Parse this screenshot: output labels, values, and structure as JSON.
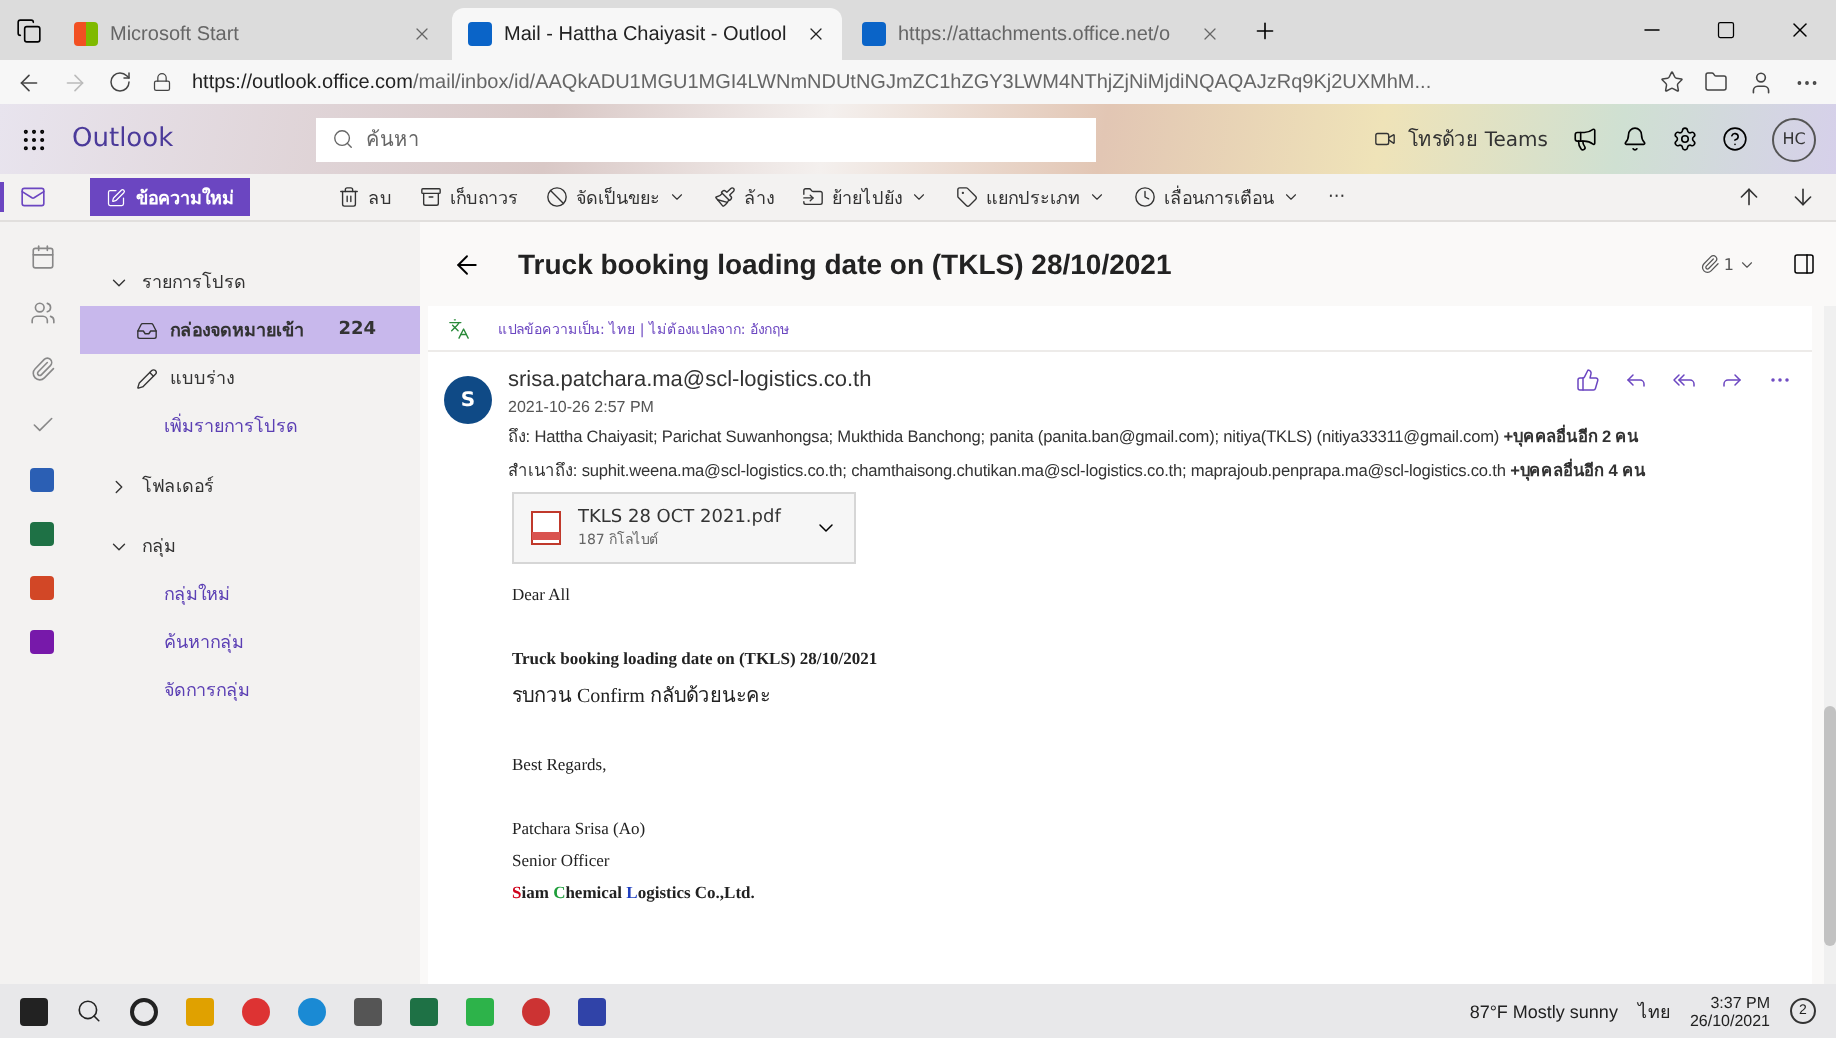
{
  "browser": {
    "tabs": [
      {
        "title": "Microsoft Start",
        "selected": false
      },
      {
        "title": "Mail - Hattha Chaiyasit - Outlool",
        "selected": true
      },
      {
        "title": "https://attachments.office.net/o",
        "selected": false
      }
    ],
    "url_host": "https://outlook.office.com",
    "url_path": "/mail/inbox/id/AAQkADU1MGU1MGI4LWNmNDUtNGJmZC1hZGY3LWM4NThjZjNiMjdiNQAQAJzRq9Kj2UXMhM..."
  },
  "header": {
    "app_name": "Outlook",
    "search_placeholder": "ค้นหา",
    "teams_label": "โทรด้วย Teams",
    "avatar_initials": "HC"
  },
  "commands": {
    "new_message": "ข้อความใหม่",
    "items": [
      {
        "label": "ลบ",
        "dropdown": false
      },
      {
        "label": "เก็บถาวร",
        "dropdown": false
      },
      {
        "label": "จัดเป็นขยะ",
        "dropdown": true
      },
      {
        "label": "ล้าง",
        "dropdown": false
      },
      {
        "label": "ย้ายไปยัง",
        "dropdown": true
      },
      {
        "label": "แยกประเภท",
        "dropdown": true
      },
      {
        "label": "เลื่อนการเตือน",
        "dropdown": true
      }
    ],
    "more": "···"
  },
  "rail": [
    {
      "selected": true
    },
    {
      "selected": false
    },
    {
      "selected": false
    },
    {
      "selected": false
    },
    {
      "selected": false
    },
    {
      "selected": false
    },
    {
      "selected": false
    },
    {
      "selected": false
    },
    {
      "selected": false
    }
  ],
  "folders": [
    {
      "label": "รายการโปรด",
      "expanded": true,
      "children": [
        {
          "label": "กล่องจดหมายเข้า",
          "count": "224",
          "kind": "inbox",
          "selected": true
        },
        {
          "label": "แบบร่าง",
          "kind": "drafts",
          "selected": false
        },
        {
          "label": "เพิ่มรายการโปรด",
          "kind": "link",
          "selected": false
        }
      ]
    },
    {
      "label": "โฟลเดอร์",
      "expanded": false
    },
    {
      "label": "กลุ่ม",
      "expanded": true,
      "children": [
        {
          "label": "กลุ่มใหม่",
          "kind": "link",
          "selected": false
        },
        {
          "label": "ค้นหากลุ่ม",
          "kind": "link",
          "selected": false
        },
        {
          "label": "จัดการกลุ่ม",
          "kind": "link",
          "selected": false
        }
      ]
    }
  ],
  "message": {
    "subject": "Truck booking loading date on (TKLS) 28/10/2021",
    "attachment_count": "1",
    "translate": {
      "text": "แปลข้อความเป็น: ไทย",
      "separator": "|",
      "skip": "ไม่ต้องแปลจาก: อังกฤษ"
    },
    "sender_initial": "S",
    "sender": "srisa.patchara.ma@scl-logistics.co.th",
    "date": "2021-10-26 2:57 PM",
    "to_label": "ถึง:",
    "to": "Hattha Chaiyasit; Parichat Suwanhongsa; Mukthida Banchong; panita (panita.ban@gmail.com); nitiya(TKLS) (nitiya33311@gmail.com)",
    "to_more": "+บุคคลอื่นอีก 2 คน",
    "cc_label": "สำเนาถึง:",
    "cc": "suphit.weena.ma@scl-logistics.co.th; chamthaisong.chutikan.ma@scl-logistics.co.th; maprajoub.penprapa.ma@scl-logistics.co.th",
    "cc_more": "+บุคคลอื่นอีก 4 คน",
    "attachment": {
      "name": "TKLS 28 OCT 2021.pdf",
      "size": "187 กิโลไบต์"
    },
    "body": [
      {
        "kind": "text",
        "text": "Dear All"
      },
      {
        "kind": "gap"
      },
      {
        "kind": "bold",
        "text": "Truck booking loading  date on (TKLS)   28/10/2021"
      },
      {
        "kind": "text",
        "text": "รบกวน Confirm กลับด้วยนะคะ"
      },
      {
        "kind": "gap"
      },
      {
        "kind": "text",
        "text": "Best Regards,"
      },
      {
        "kind": "gap"
      },
      {
        "kind": "text",
        "text": "Patchara  Srisa   (Ao)"
      },
      {
        "kind": "text",
        "text": "Senior Officer"
      },
      {
        "kind": "company",
        "parts": [
          {
            "text": "S",
            "color": "#d0021b"
          },
          {
            "text": "iam ",
            "color": "#222222"
          },
          {
            "text": "C",
            "color": "#1e9e3a"
          },
          {
            "text": "hemical ",
            "color": "#222222"
          },
          {
            "text": "L",
            "color": "#1f3fbf"
          },
          {
            "text": "ogistics Co.,Ltd.",
            "color": "#222222"
          }
        ]
      }
    ]
  },
  "taskbar": {
    "weather": "87°F  Mostly sunny",
    "language": "ไทย",
    "time": "3:37 PM",
    "date": "26/10/2021",
    "notifications": "2"
  }
}
